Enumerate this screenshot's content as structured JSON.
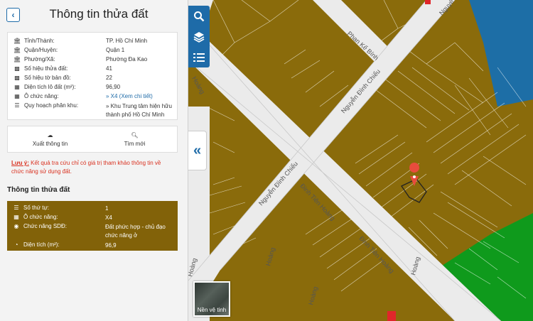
{
  "panel": {
    "title": "Thông tin thửa đất",
    "back_icon": "chevron-left-icon"
  },
  "info": [
    {
      "icon": "bank-icon",
      "label": "Tỉnh/Thành:",
      "value": "TP. Hồ Chí Minh"
    },
    {
      "icon": "bank-icon",
      "label": "Quận/Huyện:",
      "value": "Quận 1"
    },
    {
      "icon": "bank-icon",
      "label": "Phường/Xã:",
      "value": "Phường Đa Kao"
    },
    {
      "icon": "map-icon",
      "label": "Số hiệu thửa đất:",
      "value": "41"
    },
    {
      "icon": "map-icon",
      "label": "Số hiệu tờ bản đồ:",
      "value": "22"
    },
    {
      "icon": "checker-icon",
      "label": "Diện tích lô đất (m²):",
      "value": "96,90"
    },
    {
      "icon": "checker-icon",
      "label": "Ô chức năng:",
      "value": "»  X4 (Xem chi tiết)"
    },
    {
      "icon": "list-icon",
      "label": "Quy hoạch phân khu:",
      "value": "»  Khu Trung tâm hiện hữu thành phố Hồ Chí Minh"
    }
  ],
  "actions": {
    "export_label": "Xuất thông tin",
    "search_label": "Tìm mới"
  },
  "note": {
    "prefix": "Lưu ý:",
    "text": " Kết quả tra cứu chỉ có giá trị tham khảo thông tin về chức năng sử dụng đất."
  },
  "detail": {
    "title": "Thông tin thửa đất",
    "rows": [
      {
        "icon": "list-icon",
        "label": "Số thứ tự:",
        "value": "1"
      },
      {
        "icon": "grid-icon",
        "label": "Ô chức năng:",
        "value": "X4"
      },
      {
        "icon": "globe-icon",
        "label": "Chức năng SDĐ:",
        "value": "Đất phức hợp - chủ đạo chức năng ở"
      },
      {
        "icon": "pie-icon",
        "label": "Diện tích (m²):",
        "value": "96,9"
      }
    ]
  },
  "map": {
    "tools": [
      "search-icon",
      "layers-icon",
      "list-icon"
    ],
    "collapse_icon": "double-chevron-left-icon",
    "basemap_label": "Nền vệ tinh",
    "street_labels": [
      "Phan Kế Bính",
      "Nguyễn Đình Chiểu",
      "Nguyễn Đình Chiểu",
      "Đinh Tiên Hoàng",
      "Đinh Tiên Hoàng",
      "Hoàng",
      "Nguyê",
      "Hoàng",
      "Hoàng",
      "Hoàng",
      "Hoàng"
    ],
    "colors": {
      "land": "#8a6b0b",
      "road": "#ebebeb",
      "green": "#0f9a1c",
      "water": "#1d6ea6",
      "marker": "#e84c3d"
    }
  }
}
